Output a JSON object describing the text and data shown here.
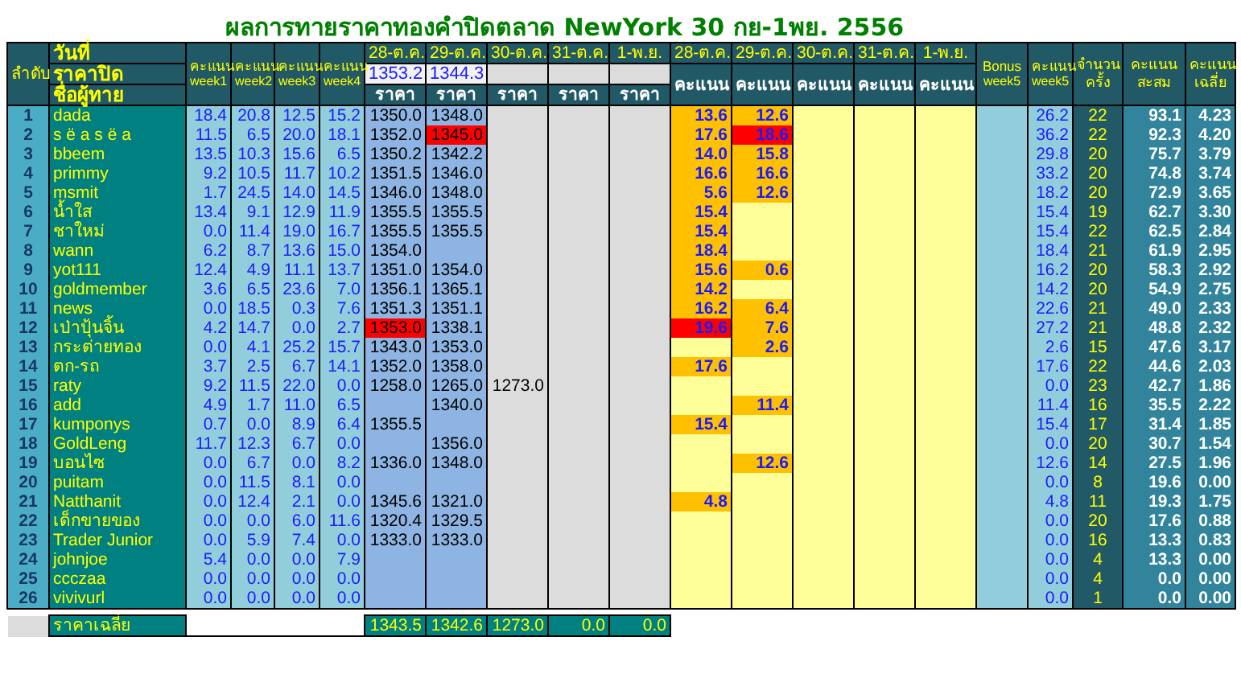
{
  "title": "ผลการทายราคาทองคำปิดตลาด NewYork 30 กย-1พย. 2556",
  "header": {
    "rank_label": "ลำดับ",
    "date_label": "วันที่",
    "close_label": "ราคาปิด",
    "name_label": "ชื่อผู้ทาย",
    "week_columns": [
      {
        "top": "คะแนน",
        "bottom": "week1"
      },
      {
        "top": "คะแนน",
        "bottom": "week2"
      },
      {
        "top": "คะแนน",
        "bottom": "week3"
      },
      {
        "top": "คะแนน",
        "bottom": "week4"
      }
    ],
    "price_dates": [
      "28-ต.ค.",
      "29-ต.ค.",
      "30-ต.ค.",
      "31-ต.ค.",
      "1-พ.ย."
    ],
    "closing_prices": {
      "oct_28": "1353.2",
      "oct_29": "1344.3"
    },
    "price_labels": [
      "ราคา",
      "ราคา",
      "ราคา",
      "ราคา",
      "ราคา"
    ],
    "score_dates": [
      "28-ต.ค.",
      "29-ต.ค.",
      "30-ต.ค.",
      "31-ต.ค.",
      "1-พ.ย."
    ],
    "score_labels": [
      "คะแนน",
      "คะแนน",
      "คะแนน",
      "คะแนน",
      "คะแนน"
    ],
    "bonus": {
      "top": "Bonus",
      "bottom": "week5"
    },
    "week5": {
      "top": "คะแนน",
      "bottom": "week5"
    },
    "count_label": "จำนวนครั้ง",
    "total_label": "คะแนนสะสม",
    "average_label": "คะแนนเฉลี่ย"
  },
  "rows": [
    {
      "rank": "1",
      "name": "dada",
      "weeks": [
        "18.4",
        "20.8",
        "12.5",
        "15.2"
      ],
      "prices": {
        "oct_28": {
          "value": "1350.0",
          "highlighted": false
        },
        "oct_29": {
          "value": "1348.0",
          "highlighted": false
        }
      },
      "scores": {
        "oct_28": {
          "value": "13.6",
          "highlighted": false
        },
        "oct_29": {
          "value": "12.6",
          "highlighted": false
        }
      },
      "week5": "26.2",
      "count": "22",
      "total": "93.1",
      "average": "4.23"
    },
    {
      "rank": "2",
      "name": "s ë a s ë a",
      "weeks": [
        "11.5",
        "6.5",
        "20.0",
        "18.1"
      ],
      "prices": {
        "oct_28": {
          "value": "1352.0",
          "highlighted": false
        },
        "oct_29": {
          "value": "1345.0",
          "highlighted": true
        }
      },
      "scores": {
        "oct_28": {
          "value": "17.6",
          "highlighted": false
        },
        "oct_29": {
          "value": "18.6",
          "highlighted": true
        }
      },
      "week5": "36.2",
      "count": "22",
      "total": "92.3",
      "average": "4.20"
    },
    {
      "rank": "3",
      "name": "bbeem",
      "weeks": [
        "13.5",
        "10.3",
        "15.6",
        "6.5"
      ],
      "prices": {
        "oct_28": {
          "value": "1350.2",
          "highlighted": false
        },
        "oct_29": {
          "value": "1342.2",
          "highlighted": false
        }
      },
      "scores": {
        "oct_28": {
          "value": "14.0",
          "highlighted": false
        },
        "oct_29": {
          "value": "15.8",
          "highlighted": false
        }
      },
      "week5": "29.8",
      "count": "20",
      "total": "75.7",
      "average": "3.79"
    },
    {
      "rank": "4",
      "name": "primmy",
      "weeks": [
        "9.2",
        "10.5",
        "11.7",
        "10.2"
      ],
      "prices": {
        "oct_28": {
          "value": "1351.5",
          "highlighted": false
        },
        "oct_29": {
          "value": "1346.0",
          "highlighted": false
        }
      },
      "scores": {
        "oct_28": {
          "value": "16.6",
          "highlighted": false
        },
        "oct_29": {
          "value": "16.6",
          "highlighted": false
        }
      },
      "week5": "33.2",
      "count": "20",
      "total": "74.8",
      "average": "3.74"
    },
    {
      "rank": "5",
      "name": "msmit",
      "weeks": [
        "1.7",
        "24.5",
        "14.0",
        "14.5"
      ],
      "prices": {
        "oct_28": {
          "value": "1346.0",
          "highlighted": false
        },
        "oct_29": {
          "value": "1348.0",
          "highlighted": false
        }
      },
      "scores": {
        "oct_28": {
          "value": "5.6",
          "highlighted": false
        },
        "oct_29": {
          "value": "12.6",
          "highlighted": false
        }
      },
      "week5": "18.2",
      "count": "20",
      "total": "72.9",
      "average": "3.65"
    },
    {
      "rank": "6",
      "name": "น้ำใส",
      "weeks": [
        "13.4",
        "9.1",
        "12.9",
        "11.9"
      ],
      "prices": {
        "oct_28": {
          "value": "1355.5",
          "highlighted": false
        },
        "oct_29": {
          "value": "1355.5",
          "highlighted": false
        }
      },
      "scores": {
        "oct_28": {
          "value": "15.4",
          "highlighted": false
        }
      },
      "week5": "15.4",
      "count": "19",
      "total": "62.7",
      "average": "3.30"
    },
    {
      "rank": "7",
      "name": "ชาใหม่",
      "weeks": [
        "0.0",
        "11.4",
        "19.0",
        "16.7"
      ],
      "prices": {
        "oct_28": {
          "value": "1355.5",
          "highlighted": false
        },
        "oct_29": {
          "value": "1355.5",
          "highlighted": false
        }
      },
      "scores": {
        "oct_28": {
          "value": "15.4",
          "highlighted": false
        }
      },
      "week5": "15.4",
      "count": "22",
      "total": "62.5",
      "average": "2.84"
    },
    {
      "rank": "8",
      "name": "wann",
      "weeks": [
        "6.2",
        "8.7",
        "13.6",
        "15.0"
      ],
      "prices": {
        "oct_28": {
          "value": "1354.0",
          "highlighted": false
        }
      },
      "scores": {
        "oct_28": {
          "value": "18.4",
          "highlighted": false
        }
      },
      "week5": "18.4",
      "count": "21",
      "total": "61.9",
      "average": "2.95"
    },
    {
      "rank": "9",
      "name": "yot111",
      "weeks": [
        "12.4",
        "4.9",
        "11.1",
        "13.7"
      ],
      "prices": {
        "oct_28": {
          "value": "1351.0",
          "highlighted": false
        },
        "oct_29": {
          "value": "1354.0",
          "highlighted": false
        }
      },
      "scores": {
        "oct_28": {
          "value": "15.6",
          "highlighted": false
        },
        "oct_29": {
          "value": "0.6",
          "highlighted": false
        }
      },
      "week5": "16.2",
      "count": "20",
      "total": "58.3",
      "average": "2.92"
    },
    {
      "rank": "10",
      "name": "goldmember",
      "weeks": [
        "3.6",
        "6.5",
        "23.6",
        "7.0"
      ],
      "prices": {
        "oct_28": {
          "value": "1356.1",
          "highlighted": false
        },
        "oct_29": {
          "value": "1365.1",
          "highlighted": false
        }
      },
      "scores": {
        "oct_28": {
          "value": "14.2",
          "highlighted": false
        }
      },
      "week5": "14.2",
      "count": "20",
      "total": "54.9",
      "average": "2.75"
    },
    {
      "rank": "11",
      "name": "news",
      "weeks": [
        "0.0",
        "18.5",
        "0.3",
        "7.6"
      ],
      "prices": {
        "oct_28": {
          "value": "1351.3",
          "highlighted": false
        },
        "oct_29": {
          "value": "1351.1",
          "highlighted": false
        }
      },
      "scores": {
        "oct_28": {
          "value": "16.2",
          "highlighted": false
        },
        "oct_29": {
          "value": "6.4",
          "highlighted": false
        }
      },
      "week5": "22.6",
      "count": "21",
      "total": "49.0",
      "average": "2.33"
    },
    {
      "rank": "12",
      "name": "เป่าปุ้นจิ้น",
      "weeks": [
        "4.2",
        "14.7",
        "0.0",
        "2.7"
      ],
      "prices": {
        "oct_28": {
          "value": "1353.0",
          "highlighted": true
        },
        "oct_29": {
          "value": "1338.1",
          "highlighted": false
        }
      },
      "scores": {
        "oct_28": {
          "value": "19.6",
          "highlighted": true
        },
        "oct_29": {
          "value": "7.6",
          "highlighted": false
        }
      },
      "week5": "27.2",
      "count": "21",
      "total": "48.8",
      "average": "2.32"
    },
    {
      "rank": "13",
      "name": "กระต่ายทอง",
      "weeks": [
        "0.0",
        "4.1",
        "25.2",
        "15.7"
      ],
      "prices": {
        "oct_28": {
          "value": "1343.0",
          "highlighted": false
        },
        "oct_29": {
          "value": "1353.0",
          "highlighted": false
        }
      },
      "scores": {
        "oct_29": {
          "value": "2.6",
          "highlighted": false
        }
      },
      "week5": "2.6",
      "count": "15",
      "total": "47.6",
      "average": "3.17"
    },
    {
      "rank": "14",
      "name": "ตก-รถ",
      "weeks": [
        "3.7",
        "2.5",
        "6.7",
        "14.1"
      ],
      "prices": {
        "oct_28": {
          "value": "1352.0",
          "highlighted": false
        },
        "oct_29": {
          "value": "1358.0",
          "highlighted": false
        }
      },
      "scores": {
        "oct_28": {
          "value": "17.6",
          "highlighted": false
        }
      },
      "week5": "17.6",
      "count": "22",
      "total": "44.6",
      "average": "2.03"
    },
    {
      "rank": "15",
      "name": "raty",
      "weeks": [
        "9.2",
        "11.5",
        "22.0",
        "0.0"
      ],
      "prices": {
        "oct_28": {
          "value": "1258.0",
          "highlighted": false
        },
        "oct_29": {
          "value": "1265.0",
          "highlighted": false
        },
        "oct_30": {
          "value": "1273.0",
          "highlighted": false
        }
      },
      "scores": {},
      "week5": "0.0",
      "count": "23",
      "total": "42.7",
      "average": "1.86"
    },
    {
      "rank": "16",
      "name": "add",
      "weeks": [
        "4.9",
        "1.7",
        "11.0",
        "6.5"
      ],
      "prices": {
        "oct_29": {
          "value": "1340.0",
          "highlighted": false
        }
      },
      "scores": {
        "oct_29": {
          "value": "11.4",
          "highlighted": false
        }
      },
      "week5": "11.4",
      "count": "16",
      "total": "35.5",
      "average": "2.22"
    },
    {
      "rank": "17",
      "name": "kumponys",
      "weeks": [
        "0.7",
        "0.0",
        "8.9",
        "6.4"
      ],
      "prices": {
        "oct_28": {
          "value": "1355.5",
          "highlighted": false
        }
      },
      "scores": {
        "oct_28": {
          "value": "15.4",
          "highlighted": false
        }
      },
      "week5": "15.4",
      "count": "17",
      "total": "31.4",
      "average": "1.85"
    },
    {
      "rank": "18",
      "name": "GoldLeng",
      "weeks": [
        "11.7",
        "12.3",
        "6.7",
        "0.0"
      ],
      "prices": {
        "oct_29": {
          "value": "1356.0",
          "highlighted": false
        }
      },
      "scores": {},
      "week5": "0.0",
      "count": "20",
      "total": "30.7",
      "average": "1.54"
    },
    {
      "rank": "19",
      "name": "บอนไซ",
      "weeks": [
        "0.0",
        "6.7",
        "0.0",
        "8.2"
      ],
      "prices": {
        "oct_28": {
          "value": "1336.0",
          "highlighted": false
        },
        "oct_29": {
          "value": "1348.0",
          "highlighted": false
        }
      },
      "scores": {
        "oct_29": {
          "value": "12.6",
          "highlighted": false
        }
      },
      "week5": "12.6",
      "count": "14",
      "total": "27.5",
      "average": "1.96"
    },
    {
      "rank": "20",
      "name": "puitam",
      "weeks": [
        "0.0",
        "11.5",
        "8.1",
        "0.0"
      ],
      "prices": {},
      "scores": {},
      "week5": "0.0",
      "count": "8",
      "total": "19.6",
      "average": "0.00"
    },
    {
      "rank": "21",
      "name": "Natthanit",
      "weeks": [
        "0.0",
        "12.4",
        "2.1",
        "0.0"
      ],
      "prices": {
        "oct_28": {
          "value": "1345.6",
          "highlighted": false
        },
        "oct_29": {
          "value": "1321.0",
          "highlighted": false
        }
      },
      "scores": {
        "oct_28": {
          "value": "4.8",
          "highlighted": false
        }
      },
      "week5": "4.8",
      "count": "11",
      "total": "19.3",
      "average": "1.75"
    },
    {
      "rank": "22",
      "name": "เด็กขายของ",
      "weeks": [
        "0.0",
        "0.0",
        "6.0",
        "11.6"
      ],
      "prices": {
        "oct_28": {
          "value": "1320.4",
          "highlighted": false
        },
        "oct_29": {
          "value": "1329.5",
          "highlighted": false
        }
      },
      "scores": {},
      "week5": "0.0",
      "count": "20",
      "total": "17.6",
      "average": "0.88"
    },
    {
      "rank": "23",
      "name": "Trader Junior",
      "weeks": [
        "0.0",
        "5.9",
        "7.4",
        "0.0"
      ],
      "prices": {
        "oct_28": {
          "value": "1333.0",
          "highlighted": false
        },
        "oct_29": {
          "value": "1333.0",
          "highlighted": false
        }
      },
      "scores": {},
      "week5": "0.0",
      "count": "16",
      "total": "13.3",
      "average": "0.83"
    },
    {
      "rank": "24",
      "name": "johnjoe",
      "weeks": [
        "5.4",
        "0.0",
        "0.0",
        "7.9"
      ],
      "prices": {},
      "scores": {},
      "week5": "0.0",
      "count": "4",
      "total": "13.3",
      "average": "0.00"
    },
    {
      "rank": "25",
      "name": "ccczaa",
      "weeks": [
        "0.0",
        "0.0",
        "0.0",
        "0.0"
      ],
      "prices": {},
      "scores": {},
      "week5": "0.0",
      "count": "4",
      "total": "0.0",
      "average": "0.00"
    },
    {
      "rank": "26",
      "name": "vivivurl",
      "weeks": [
        "0.0",
        "0.0",
        "0.0",
        "0.0"
      ],
      "prices": {},
      "scores": {},
      "week5": "0.0",
      "count": "1",
      "total": "0.0",
      "average": "0.00"
    }
  ],
  "footer": {
    "label": "ราคาเฉลี่ย",
    "averages": [
      "1343.5",
      "1342.6",
      "1273.0",
      "0.0",
      "0.0"
    ]
  }
}
